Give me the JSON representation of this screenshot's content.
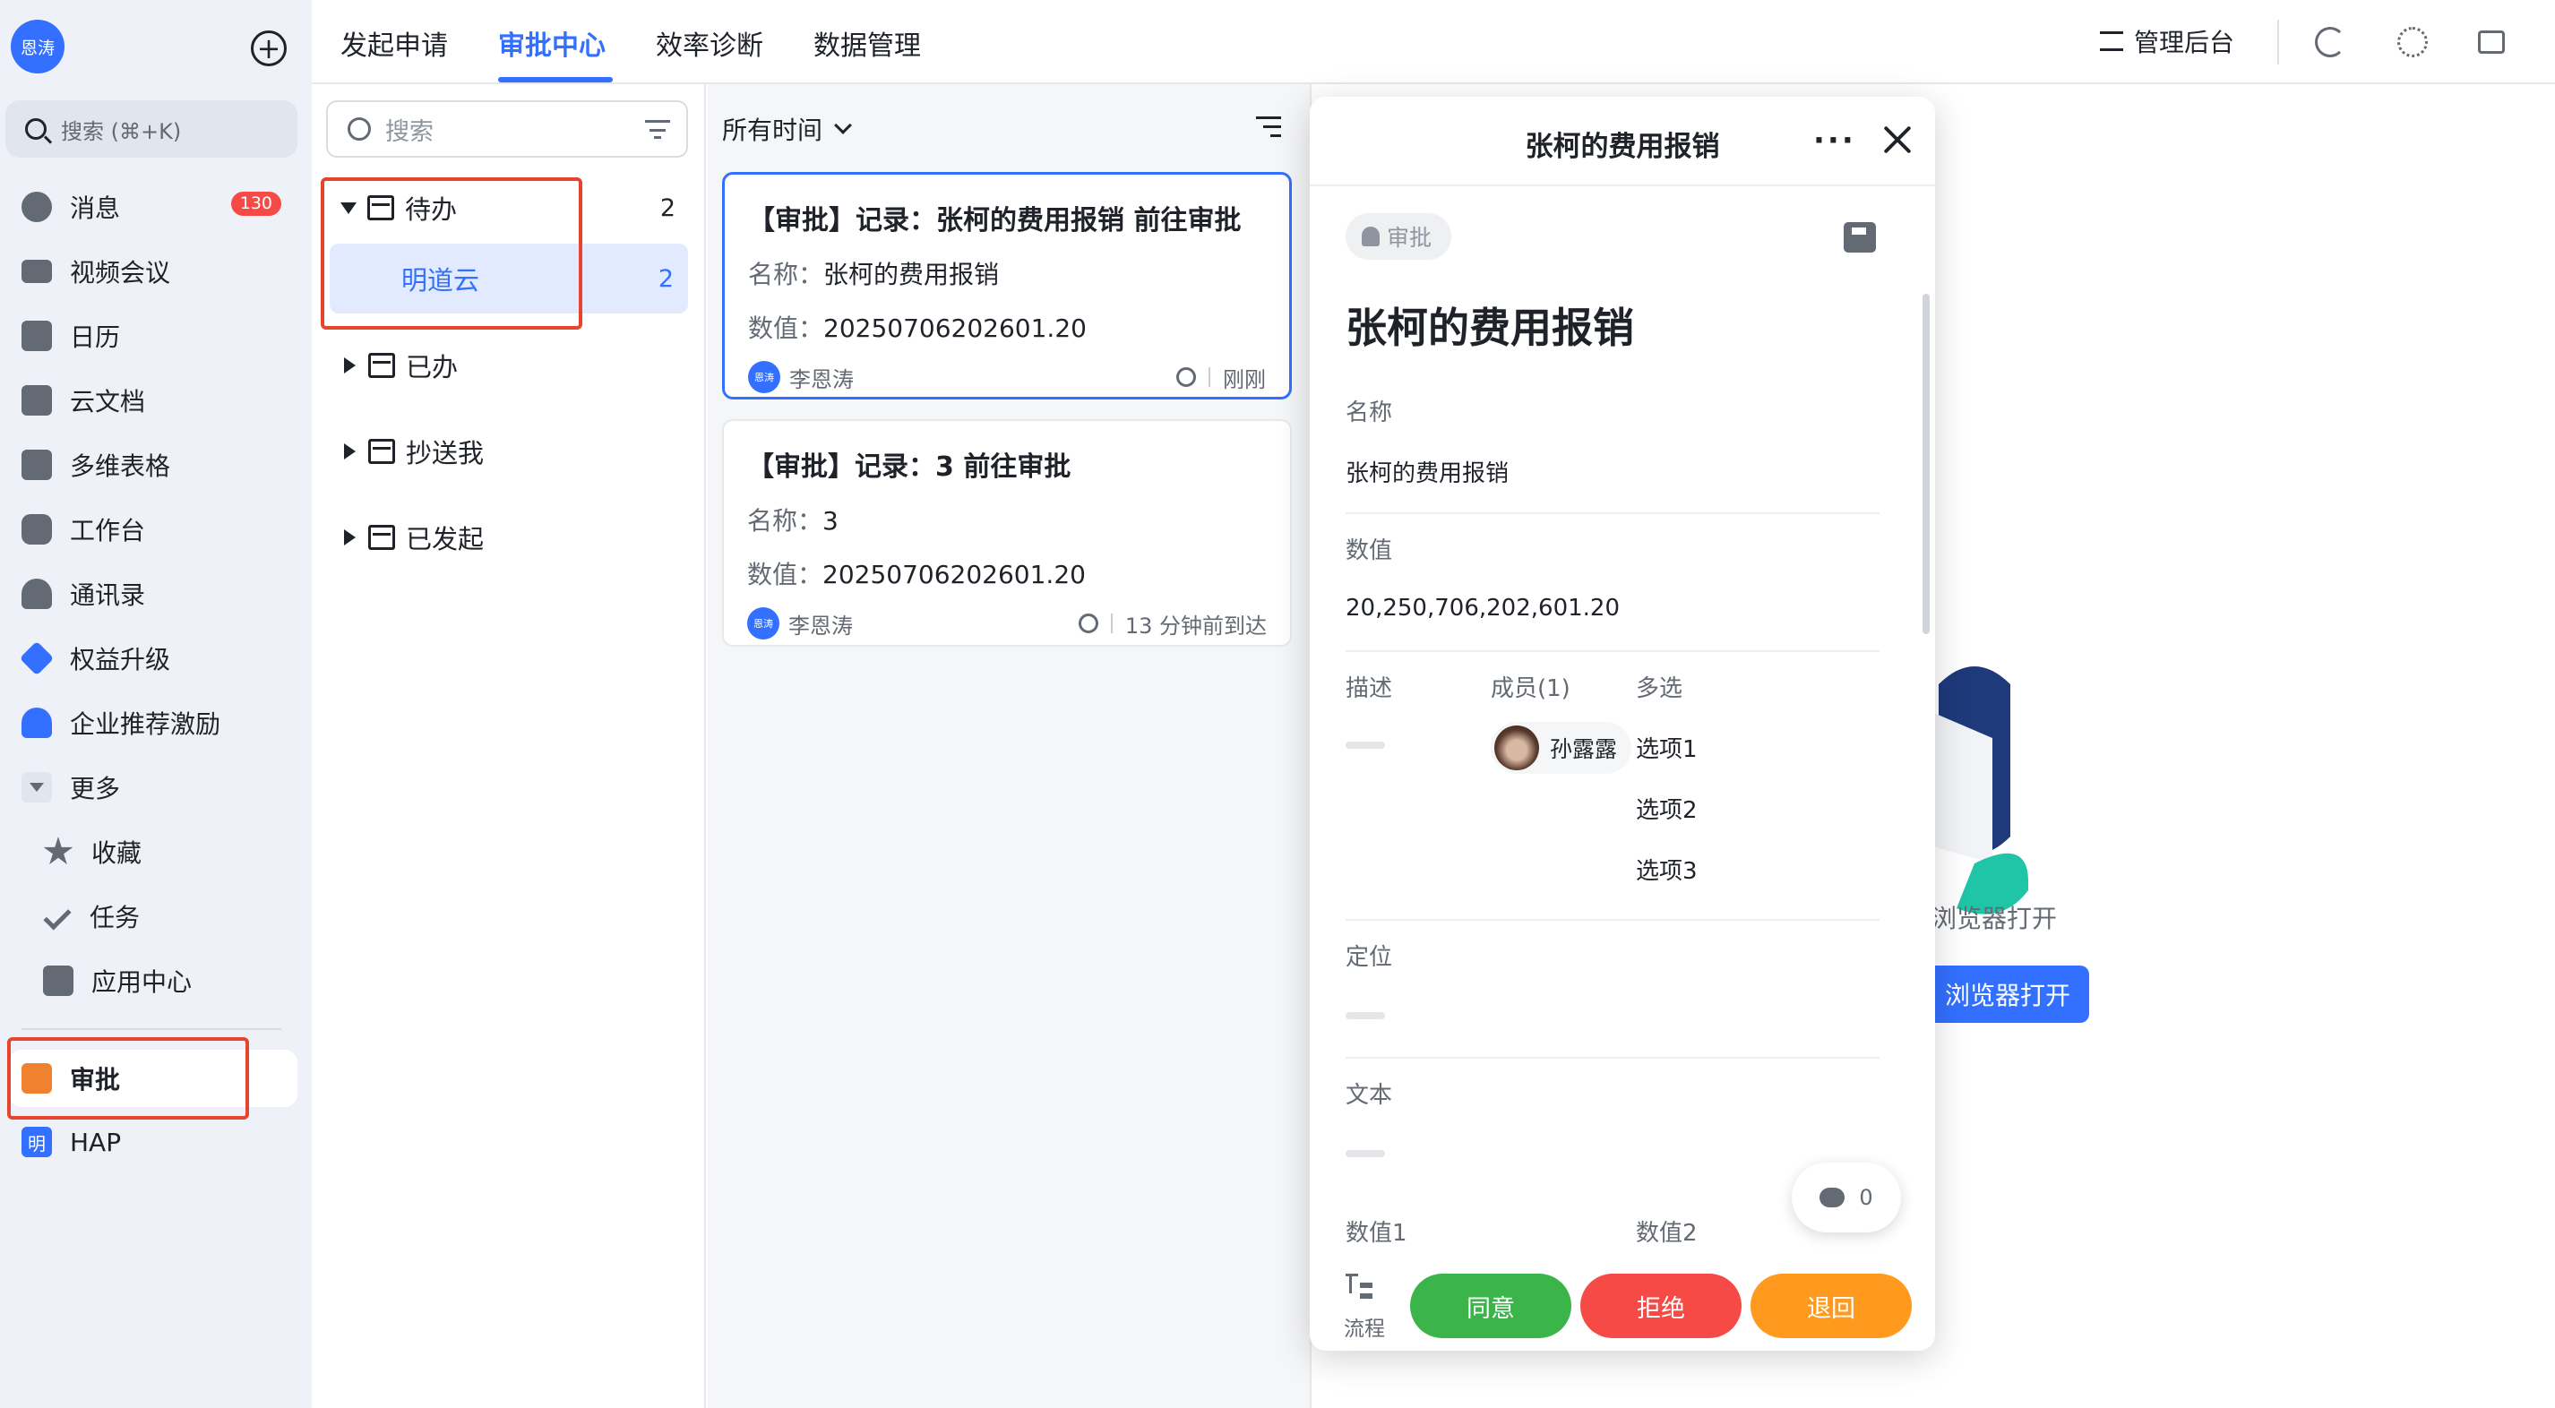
{
  "sidebar": {
    "avatar": "恩涛",
    "search_placeholder": "搜索 (⌘+K)",
    "items": [
      {
        "label": "消息",
        "badge": "130"
      },
      {
        "label": "视频会议"
      },
      {
        "label": "日历"
      },
      {
        "label": "云文档"
      },
      {
        "label": "多维表格"
      },
      {
        "label": "工作台"
      },
      {
        "label": "通讯录"
      },
      {
        "label": "权益升级"
      },
      {
        "label": "企业推荐激励"
      },
      {
        "label": "更多"
      },
      {
        "label": "收藏"
      },
      {
        "label": "任务"
      },
      {
        "label": "应用中心"
      },
      {
        "label": "审批"
      },
      {
        "label": "HAP"
      }
    ],
    "icon_colors": {
      "approval": "#f0822f",
      "hap": "#3370ff",
      "upgrade": "#3370ff"
    }
  },
  "topbar": {
    "tabs": [
      "发起申请",
      "审批中心",
      "效率诊断",
      "数据管理"
    ],
    "active_tab": "审批中心",
    "admin_label": "管理后台"
  },
  "filter": {
    "search_placeholder": "搜索",
    "tree": [
      {
        "label": "待办",
        "count": "2",
        "expanded": true,
        "children": [
          {
            "label": "明道云",
            "count": "2"
          }
        ]
      },
      {
        "label": "已办"
      },
      {
        "label": "抄送我"
      },
      {
        "label": "已发起"
      }
    ]
  },
  "list": {
    "time_filter": "所有时间",
    "cards": [
      {
        "title": "【审批】记录：张柯的费用报销 前往审批",
        "name_label": "名称：",
        "name_value": "张柯的费用报销",
        "number_label": "数值：",
        "number_value": "20250706202601.20",
        "avatar": "恩涛",
        "user": "李恩涛",
        "time": "刚刚"
      },
      {
        "title": "【审批】记录：3 前往审批",
        "name_label": "名称：",
        "name_value": "3",
        "number_label": "数值：",
        "number_value": "20250706202601.20",
        "avatar": "恩涛",
        "user": "李恩涛",
        "time": "13 分钟前到达"
      }
    ]
  },
  "background": {
    "hint_text": "浏览器打开",
    "button_label": "浏览器打开"
  },
  "panel": {
    "header_title": "张柯的费用报销",
    "tag": "审批",
    "record_title": "张柯的费用报销",
    "fields": {
      "name_label": "名称",
      "name_value": "张柯的费用报销",
      "number_label": "数值",
      "number_value": "20,250,706,202,601.20",
      "desc_label": "描述",
      "members_label": "成员(1)",
      "member_name": "孙露露",
      "multi_label": "多选",
      "options": [
        "选项1",
        "选项2",
        "选项3"
      ],
      "location_label": "定位",
      "text_label": "文本",
      "number1_label": "数值1",
      "number2_label": "数值2"
    },
    "comment_count": "0",
    "flow_label": "流程",
    "actions": [
      {
        "label": "同意",
        "color": "#3bb54a"
      },
      {
        "label": "拒绝",
        "color": "#f54a45"
      },
      {
        "label": "退回",
        "color": "#ff9a1f"
      }
    ]
  }
}
